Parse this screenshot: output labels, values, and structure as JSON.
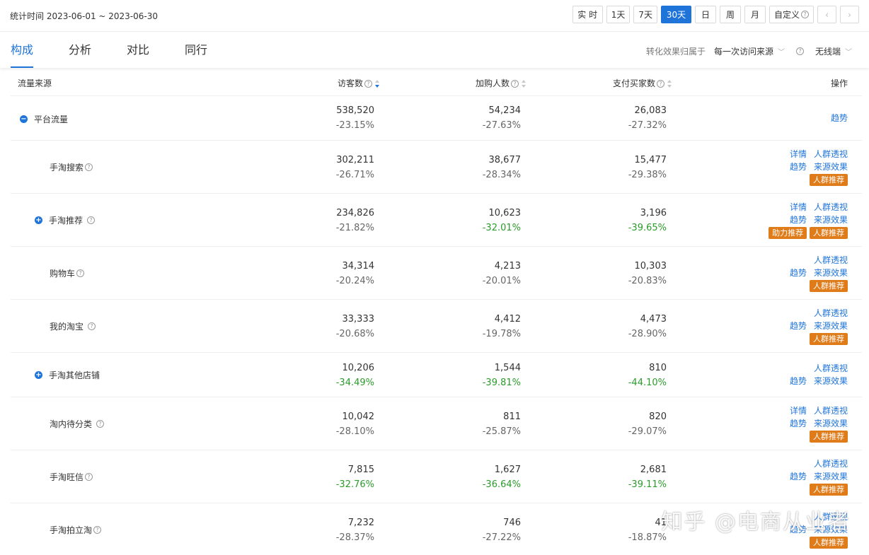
{
  "header": {
    "stat_label": "统计时间",
    "date_range": "2023-06-01 ~ 2023-06-30",
    "range_buttons": [
      "实 时",
      "1天",
      "7天",
      "30天",
      "日",
      "周",
      "月"
    ],
    "active_range": "30天",
    "custom_label": "自定义",
    "prev_arrow": "‹",
    "next_arrow": "›"
  },
  "tabs": [
    "构成",
    "分析",
    "对比",
    "同行"
  ],
  "active_tab": "构成",
  "attribution": {
    "label": "转化效果归属于",
    "value": "每一次访问来源",
    "device": "无线端"
  },
  "columns": {
    "source": "流量来源",
    "visitors": "访客数",
    "cart": "加购人数",
    "buyers": "支付买家数",
    "ops": "操作"
  },
  "op_labels": {
    "detail": "详情",
    "persona": "人群透视",
    "trend": "趋势",
    "effect": "来源效果",
    "crowd_recommend": "人群推荐",
    "boost_recommend": "助力推荐"
  },
  "rows": [
    {
      "name": "平台流量",
      "expand": "minus",
      "help": false,
      "visitors": "538,520",
      "visitors_chg": "-23.15%",
      "cart": "54,234",
      "cart_chg": "-27.63%",
      "buyers": "26,083",
      "buyers_chg": "-27.32%"
    },
    {
      "name": "手淘搜索",
      "help": true,
      "visitors": "302,211",
      "visitors_chg": "-26.71%",
      "cart": "38,677",
      "cart_chg": "-28.34%",
      "buyers": "15,477",
      "buyers_chg": "-29.38%"
    },
    {
      "name": "手淘推荐",
      "expand": "plus",
      "help": true,
      "visitors": "234,826",
      "visitors_chg": "-21.82%",
      "cart": "10,623",
      "cart_chg": "-32.01%",
      "buyers": "3,196",
      "buyers_chg": "-39.65%"
    },
    {
      "name": "购物车",
      "help": true,
      "visitors": "34,314",
      "visitors_chg": "-20.24%",
      "cart": "4,213",
      "cart_chg": "-20.01%",
      "buyers": "10,303",
      "buyers_chg": "-20.83%"
    },
    {
      "name": "我的淘宝",
      "help": true,
      "visitors": "33,333",
      "visitors_chg": "-20.68%",
      "cart": "4,412",
      "cart_chg": "-19.78%",
      "buyers": "4,473",
      "buyers_chg": "-28.90%"
    },
    {
      "name": "手淘其他店铺",
      "expand": "plus",
      "help": false,
      "visitors": "10,206",
      "visitors_chg": "-34.49%",
      "cart": "1,544",
      "cart_chg": "-39.81%",
      "buyers": "810",
      "buyers_chg": "-44.10%"
    },
    {
      "name": "淘内待分类",
      "help": true,
      "visitors": "10,042",
      "visitors_chg": "-28.10%",
      "cart": "811",
      "cart_chg": "-25.87%",
      "buyers": "820",
      "buyers_chg": "-29.07%"
    },
    {
      "name": "手淘旺信",
      "help": true,
      "visitors": "7,815",
      "visitors_chg": "-32.76%",
      "cart": "1,627",
      "cart_chg": "-36.64%",
      "buyers": "2,681",
      "buyers_chg": "-39.11%"
    },
    {
      "name": "手淘拍立淘",
      "help": true,
      "visitors": "7,232",
      "visitors_chg": "-28.37%",
      "cart": "746",
      "cart_chg": "-27.22%",
      "buyers": "41",
      "buyers_chg": "-18.87%"
    }
  ],
  "watermark": "知乎 @电商从业者",
  "colors": {
    "accent": "#1f74d9",
    "orange": "#e07b1a",
    "green": "#2a9c2a"
  }
}
